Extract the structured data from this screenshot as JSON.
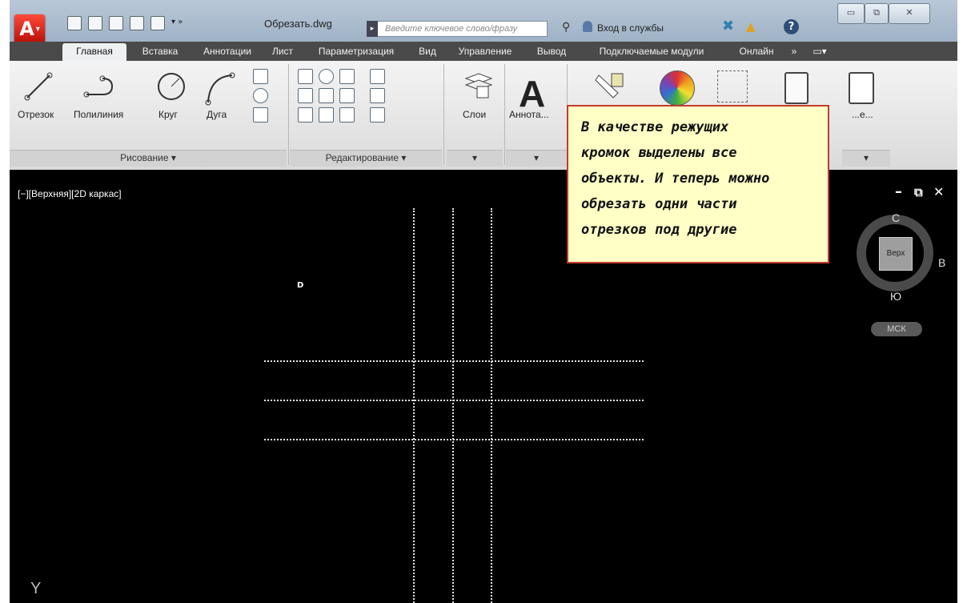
{
  "app": {
    "menu_label": "A",
    "file_name": "Обрезать.dwg",
    "search_placeholder": "Введите ключевое слово/фразу",
    "signin_label": "Вход в службы",
    "help_label": "?",
    "window_controls": [
      "▭",
      "⧉",
      "✕"
    ]
  },
  "tabs": [
    "Главная",
    "Вставка",
    "Аннотации",
    "Лист",
    "Параметризация",
    "Вид",
    "Управление",
    "Вывод",
    "Подключаемые модули",
    "Онлайн",
    "»"
  ],
  "ribbon": {
    "draw_tools": [
      "Отрезок",
      "Полилиния",
      "Круг",
      "Дуга"
    ],
    "panel_draw": "Рисование ▾",
    "panel_edit": "Редактирование ▾",
    "layers_label": "Слои",
    "annotation_label": "Аннота...",
    "paste_label": "...е...",
    "dropdown_arrows": [
      "▾",
      "▾",
      "▾"
    ]
  },
  "viewport": {
    "label": "[−][Верхняя][2D каркас]",
    "controls": [
      "–",
      "⧉",
      "✕"
    ],
    "cube_face": "Верх",
    "compass": {
      "north": "С",
      "east": "В",
      "south": "Ю"
    },
    "ucs_label": "МСК",
    "axis_y": "Y",
    "pointer_mark": "D"
  },
  "note": {
    "text": "В качестве режущих\nкромок выделены все\nобъекты. И теперь можно\nобрезать одни части\nотрезков под другие"
  },
  "colors": {
    "note_border": "#c13b2c",
    "note_background": "#ffffc6",
    "canvas": "#000000",
    "app_button": "#d0180e"
  }
}
